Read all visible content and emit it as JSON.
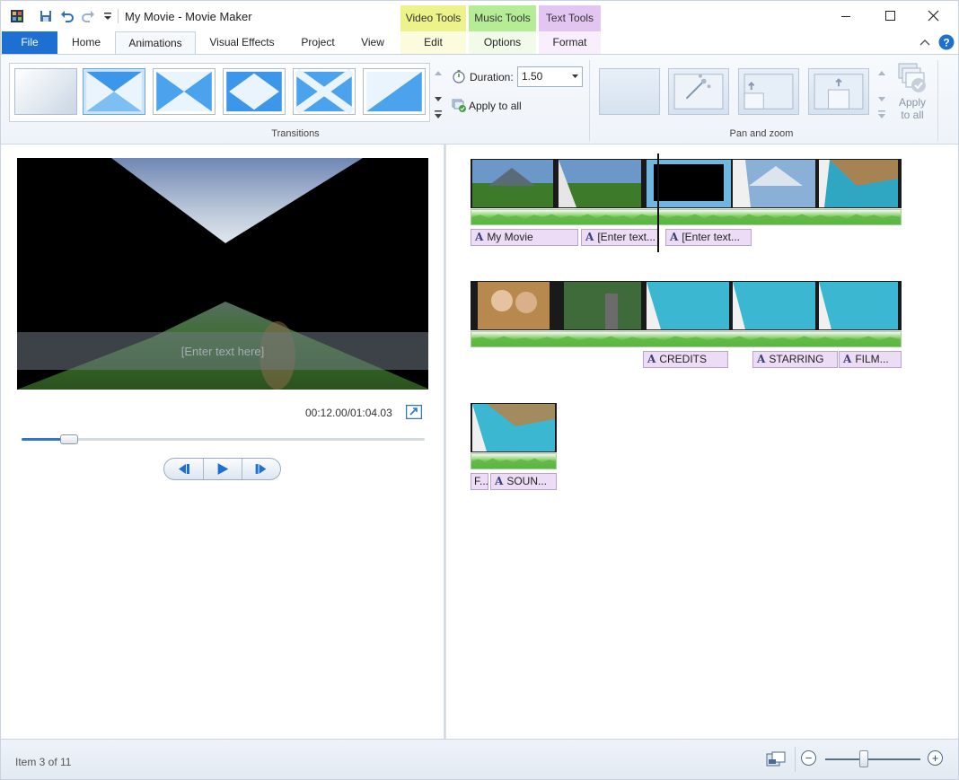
{
  "window": {
    "title": "My Movie - Movie Maker",
    "controls": {
      "minimize": "—",
      "maximize": "☐",
      "close": "✕"
    }
  },
  "context_tabs": [
    {
      "group": "Video Tools",
      "tab": "Edit",
      "color": "#eef28a"
    },
    {
      "group": "Music Tools",
      "tab": "Options",
      "color": "#b7ec96"
    },
    {
      "group": "Text Tools",
      "tab": "Format",
      "color": "#e3c5f2"
    }
  ],
  "tabs": [
    "File",
    "Home",
    "Animations",
    "Visual Effects",
    "Project",
    "View"
  ],
  "active_tab": "Animations",
  "ribbon": {
    "transitions_group": "Transitions",
    "duration_label": "Duration:",
    "duration_value": "1.50",
    "apply_to_all": "Apply to all",
    "pan_zoom_group": "Pan and zoom",
    "pz_apply_line1": "Apply",
    "pz_apply_line2": "to all"
  },
  "preview": {
    "caption_placeholder": "[Enter text here]",
    "timecode": "00:12.00/01:04.03",
    "seek_progress": 0.12
  },
  "storyboard": {
    "rows": [
      {
        "text_clips": [
          "My Movie",
          "[Enter text...",
          "[Enter text..."
        ]
      },
      {
        "text_clips": [
          "CREDITS",
          "STARRING",
          "FILM..."
        ]
      },
      {
        "text_clips": [
          "F...",
          "SOUN..."
        ]
      }
    ]
  },
  "status": {
    "item_text": "Item 3 of 11",
    "zoom_minus": "−",
    "zoom_plus": "+",
    "zoom_level": 0.4
  },
  "colors": {
    "accent": "#1d6fd1",
    "text_clip": "#eddcf6",
    "audio": "#4aa432"
  }
}
